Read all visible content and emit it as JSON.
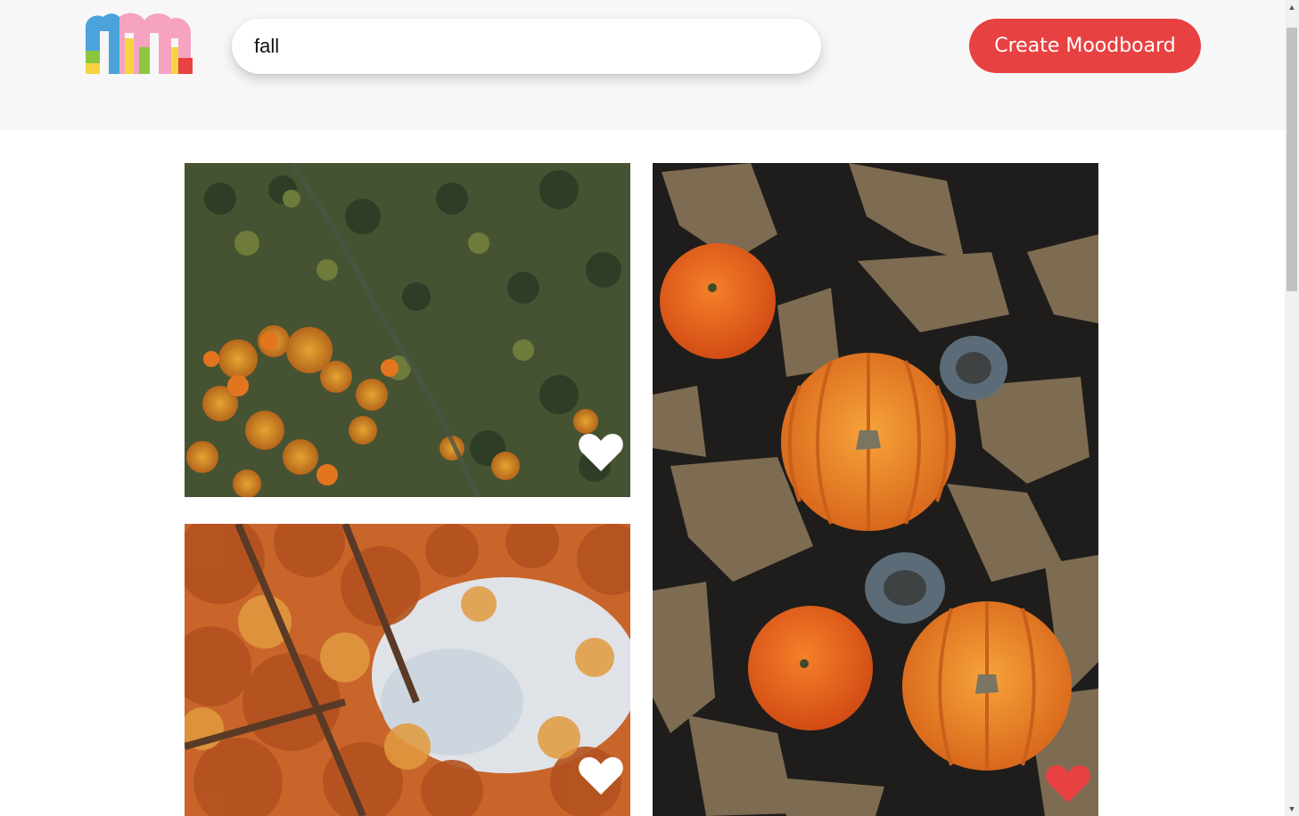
{
  "header": {
    "logo_alt": "m",
    "search": {
      "value": "fall",
      "placeholder": ""
    },
    "create_button_label": "Create Moodboard"
  },
  "colors": {
    "accent": "#e84141",
    "header_bg": "#f7f7f7",
    "heart_liked": "#e84141",
    "heart_unliked": "#ffffff"
  },
  "feed": {
    "images": [
      {
        "subject": "aerial autumn forest",
        "liked": false
      },
      {
        "subject": "pumpkins, oranges, leaves and pine cones",
        "liked": true
      },
      {
        "subject": "autumn tree canopy looking up",
        "liked": false
      }
    ]
  },
  "icons": {
    "like": "heart-icon"
  }
}
